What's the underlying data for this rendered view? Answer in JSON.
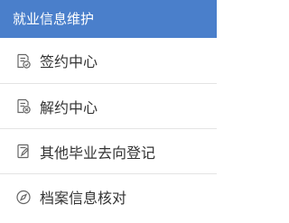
{
  "panel": {
    "title": "就业信息维护",
    "header_color": "#4a7fcb",
    "items": [
      {
        "label": "签约中心",
        "icon": "document-check-icon"
      },
      {
        "label": "解约中心",
        "icon": "document-cancel-icon"
      },
      {
        "label": "其他毕业去向登记",
        "icon": "document-edit-icon"
      },
      {
        "label": "档案信息核对",
        "icon": "compass-icon"
      }
    ]
  }
}
